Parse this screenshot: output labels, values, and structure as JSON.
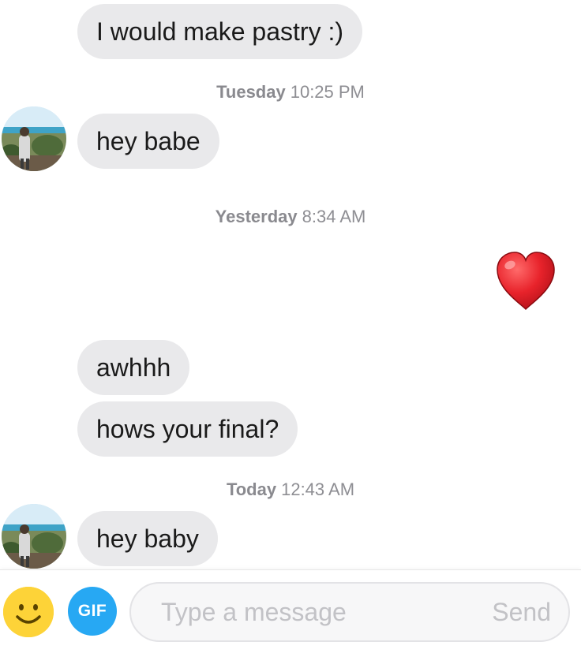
{
  "conversation": {
    "messages": [
      {
        "text": "I would make pastry :)"
      },
      {
        "text": "hey babe"
      },
      {
        "text": "awhhh"
      },
      {
        "text": "hows your final?"
      },
      {
        "text": "hey baby"
      }
    ],
    "timestamps": [
      {
        "day": "Tuesday",
        "time": "10:25 PM"
      },
      {
        "day": "Yesterday",
        "time": "8:34 AM"
      },
      {
        "day": "Today",
        "time": "12:43 AM"
      }
    ],
    "heart_emoji": "red-heart-emoji"
  },
  "composer": {
    "placeholder": "Type a message",
    "send_label": "Send",
    "gif_label": "GIF",
    "emoji_icon": "smiley-face-icon"
  },
  "colors": {
    "bubble": "#e9e9eb",
    "timestamp": "#8e8e93",
    "gif_button": "#27a8f3",
    "emoji_button": "#fdd338",
    "heart": "#e8232b"
  }
}
